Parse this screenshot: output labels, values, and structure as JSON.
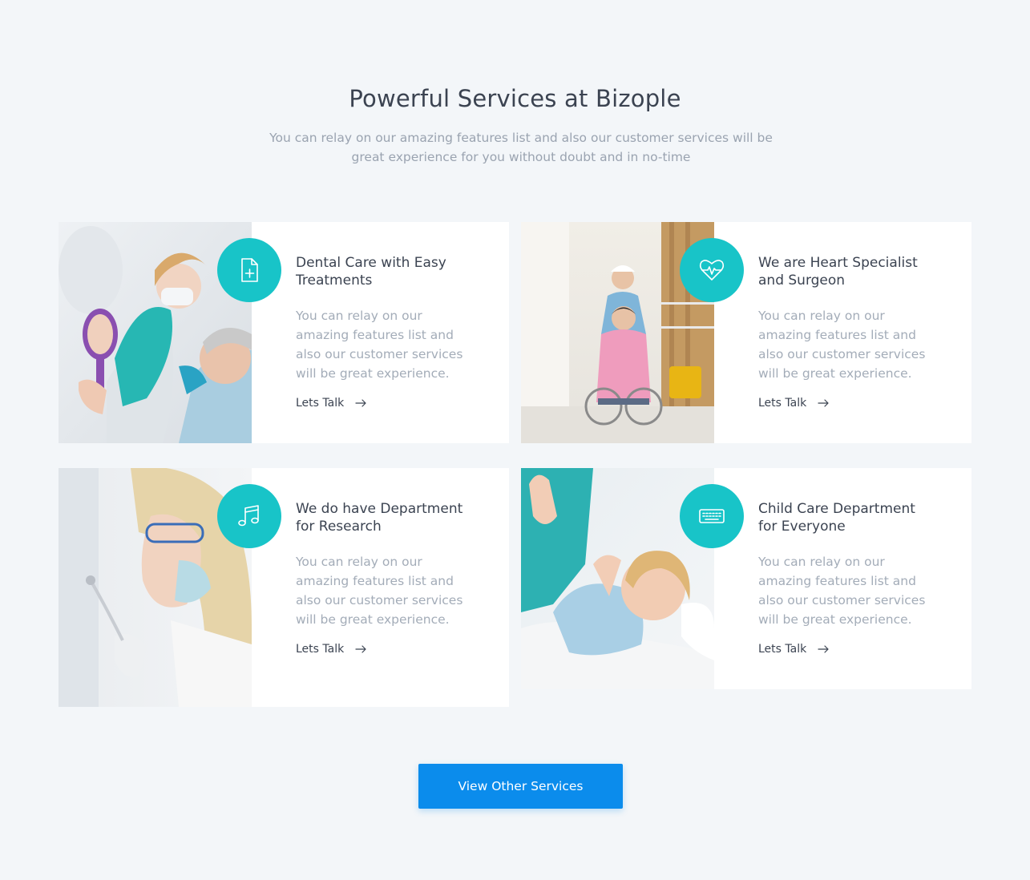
{
  "header": {
    "title": "Powerful Services at Bizople",
    "subtitle": "You can relay on our amazing features list and also our customer services will be great experience for you without doubt and in no-time"
  },
  "accent_color": "#18c4c8",
  "button_color": "#0b8cec",
  "services": [
    {
      "title": "Dental Care with Easy Treatments",
      "text": "You can relay on our amazing features list and also our customer services will be great experience.",
      "link": "Lets Talk",
      "icon": "document-plus-icon",
      "photo": "dentist-photo"
    },
    {
      "title": "We are Heart Specialist and Surgeon",
      "text": "You can relay on our amazing features list and also our customer services will be great experience.",
      "link": "Lets Talk",
      "icon": "heart-pulse-icon",
      "photo": "nurse-wheelchair-photo"
    },
    {
      "title": "We do have Department for Research",
      "text": "You can relay on our amazing features list and also our customer services will be great experience.",
      "link": "Lets Talk",
      "icon": "music-note-icon",
      "photo": "researcher-photo"
    },
    {
      "title": "Child Care Department for Everyone",
      "text": "You can relay on our amazing features list and also our customer services will be great experience.",
      "link": "Lets Talk",
      "icon": "keyboard-icon",
      "photo": "child-patient-photo"
    }
  ],
  "cta": {
    "label": "View Other Services"
  }
}
